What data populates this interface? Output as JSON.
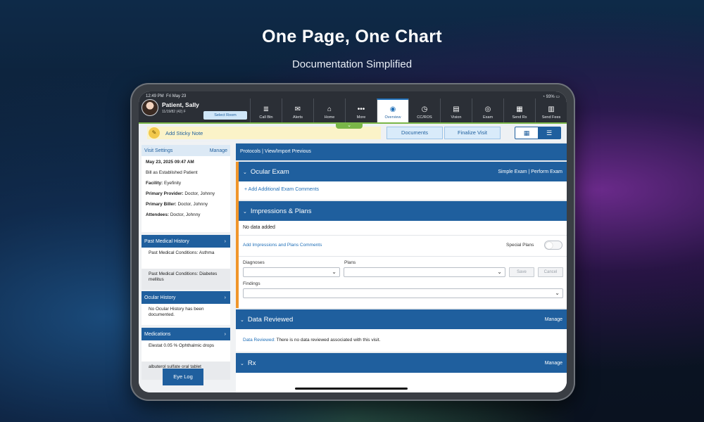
{
  "hero": {
    "title": "One Page, One Chart",
    "subtitle": "Documentation Simplified"
  },
  "status": {
    "time": "12:49 PM",
    "date": "Fri May 23",
    "battery": "93%"
  },
  "patient": {
    "name": "Patient, Sally",
    "dob": "11/19/82 (42) F",
    "select_room": "Select Room"
  },
  "nav": [
    {
      "label": "Call Btn",
      "icon": "list-icon",
      "glyph": "≣"
    },
    {
      "label": "Alerts",
      "icon": "megaphone-icon",
      "glyph": "✉"
    },
    {
      "label": "Home",
      "icon": "home-icon",
      "glyph": "⌂"
    },
    {
      "label": "More",
      "icon": "dots-icon",
      "glyph": "•••"
    },
    {
      "label": "Overview",
      "icon": "user-icon",
      "glyph": "◉"
    },
    {
      "label": "CC/ROS",
      "icon": "clock-icon",
      "glyph": "◷"
    },
    {
      "label": "Vision",
      "icon": "chart-icon",
      "glyph": "▤"
    },
    {
      "label": "Exam",
      "icon": "eye-icon",
      "glyph": "◎"
    },
    {
      "label": "Send Rx",
      "icon": "rx-icon",
      "glyph": "▦"
    },
    {
      "label": "Send Fees",
      "icon": "document-icon",
      "glyph": "▥"
    }
  ],
  "toolbar": {
    "sticky": "Add Sticky Note",
    "documents": "Documents",
    "finalize": "Finalize Visit"
  },
  "visit": {
    "title": "Visit Settings",
    "manage": "Manage",
    "datetime": "May 23, 2025 09:47 AM",
    "bill": "Bill as Established Patient",
    "facility_label": "Facility:",
    "facility": "Eyefinity",
    "provider_label": "Primary Provider:",
    "provider": "Doctor, Johnny",
    "biller_label": "Primary Biller:",
    "biller": "Doctor, Johnny",
    "attendees_label": "Attendees:",
    "attendees": "Doctor, Johnny"
  },
  "pmh": {
    "title": "Past Medical History",
    "item1": "Past Medical Conditions: Asthma",
    "item2": "Past Medical Conditions: Diabetes mellitus"
  },
  "ocular": {
    "title": "Ocular History",
    "item": "No Ocular History has been documented."
  },
  "meds": {
    "title": "Medications",
    "item1": "Elestat 0.05 % Ophthalmic drops",
    "item2": "albuterol sulfate oral tablet"
  },
  "eyelog": "Eye Log",
  "protocols": {
    "protocols": "Protocols",
    "sep": "|",
    "view": "View/Import Previous"
  },
  "exam": {
    "title": "Ocular Exam",
    "simple": "Simple Exam",
    "perform": "Perform Exam",
    "add": "+ Add Additional Exam Comments"
  },
  "impressions": {
    "title": "Impressions & Plans",
    "nodata": "No data added",
    "add": "Add Impressions and Plans Comments",
    "special": "Special Plans",
    "diagnoses": "Diagnoses",
    "plans": "Plans",
    "findings": "Findings",
    "save": "Save",
    "cancel": "Cancel"
  },
  "reviewed": {
    "title": "Data Reviewed",
    "manage": "Manage",
    "label": "Data Reviewed:",
    "text": "There is no data reviewed associated with this visit."
  },
  "rx": {
    "title": "Rx",
    "manage": "Manage"
  }
}
